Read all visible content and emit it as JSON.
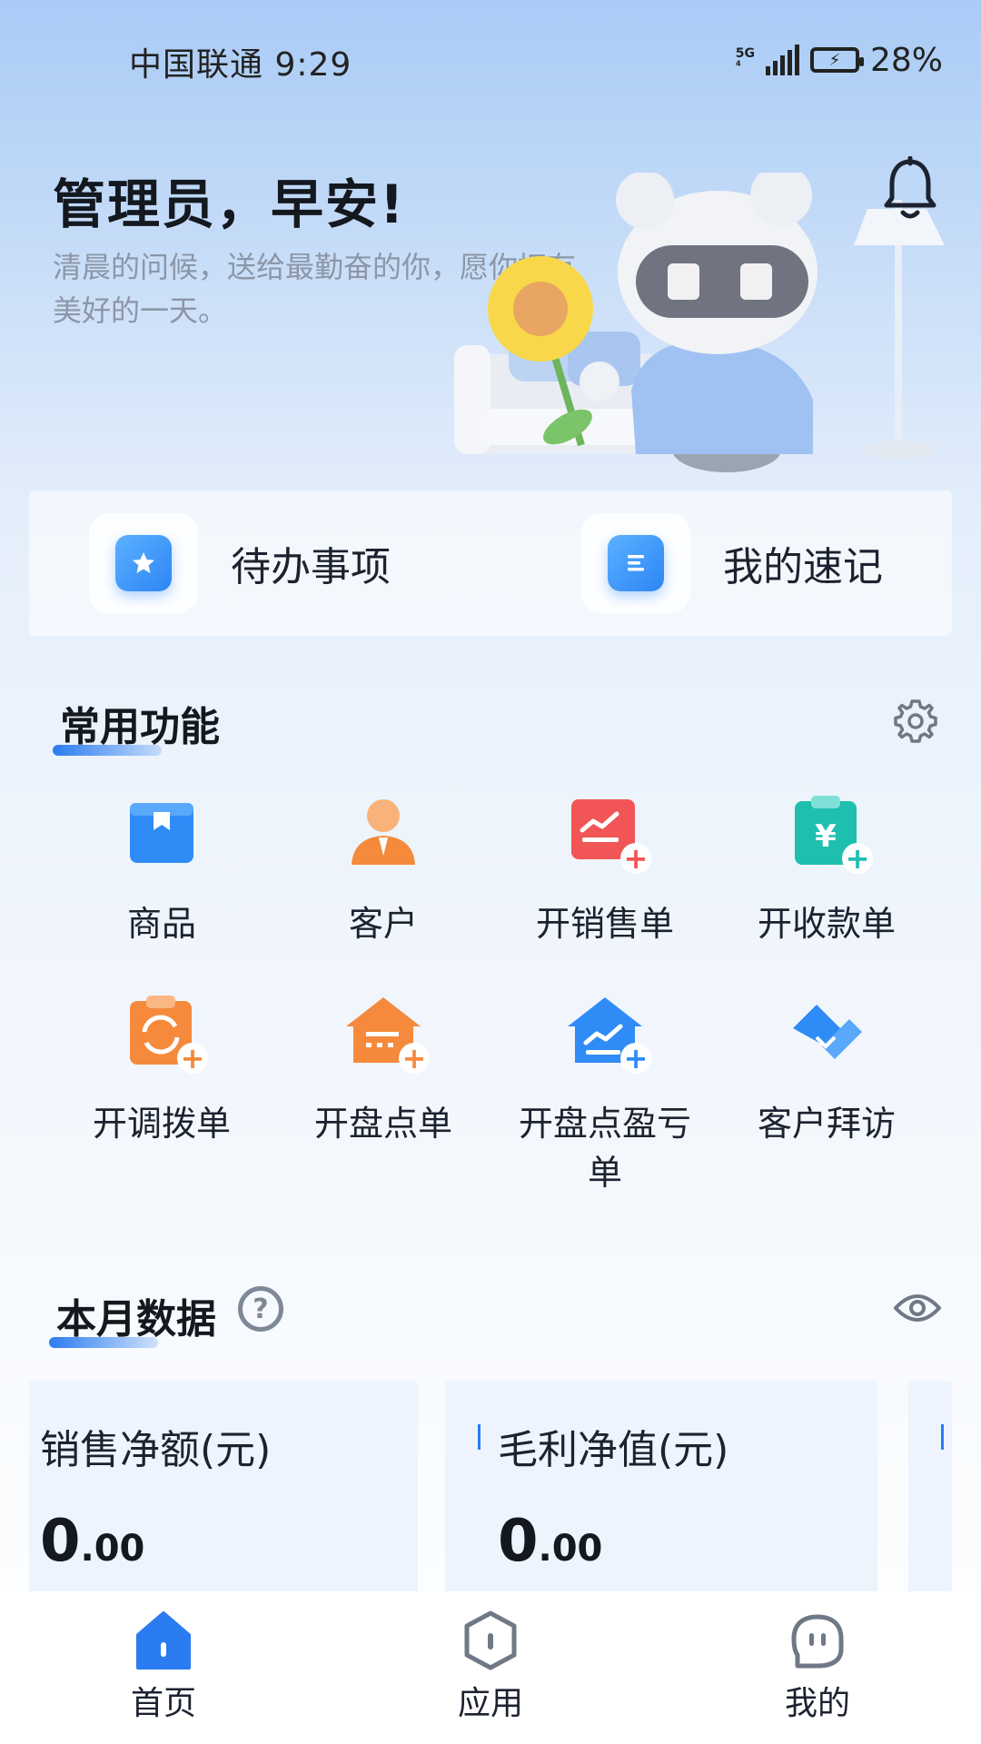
{
  "status_bar": {
    "carrier_time": "中国联通 9:29",
    "network": "5G",
    "battery_percent": "28%"
  },
  "greeting": {
    "title": "管理员，早安!",
    "subtitle": "清晨的问候，送给最勤奋的你，愿你拥有美好的一天。"
  },
  "quick_actions": [
    {
      "label": "待办事项",
      "icon": "star-icon"
    },
    {
      "label": "我的速记",
      "icon": "notes-icon"
    }
  ],
  "common_functions": {
    "title": "常用功能",
    "items": [
      {
        "label": "商品",
        "icon": "product-box-icon",
        "color": "#2f8cf6"
      },
      {
        "label": "客户",
        "icon": "customer-person-icon",
        "color": "#f58a3c"
      },
      {
        "label": "开销售单",
        "icon": "sales-order-add-icon",
        "color": "#f25555"
      },
      {
        "label": "开收款单",
        "icon": "receipt-add-icon",
        "color": "#1fbfb0"
      },
      {
        "label": "开调拨单",
        "icon": "transfer-order-add-icon",
        "color": "#f58a3c"
      },
      {
        "label": "开盘点单",
        "icon": "stocktake-add-icon",
        "color": "#f58a3c"
      },
      {
        "label": "开盘点盈亏单",
        "icon": "stocktake-profit-loss-add-icon",
        "color": "#2f8cf6"
      },
      {
        "label": "客户拜访",
        "icon": "customer-visit-icon",
        "color": "#2f8cf6"
      }
    ]
  },
  "monthly_data": {
    "title": "本月数据",
    "cards": [
      {
        "label": "销售净额(元)",
        "int": "0",
        "dec": ".00"
      },
      {
        "label": "毛利净值(元)",
        "int": "0",
        "dec": ".00"
      }
    ]
  },
  "bottom_nav": [
    {
      "label": "首页",
      "icon": "home-icon",
      "active": true
    },
    {
      "label": "应用",
      "icon": "apps-icon",
      "active": false
    },
    {
      "label": "我的",
      "icon": "profile-icon",
      "active": false
    }
  ],
  "colors": {
    "accent": "#2a7cf0",
    "text": "#1c2230",
    "muted": "#8c96a6"
  }
}
